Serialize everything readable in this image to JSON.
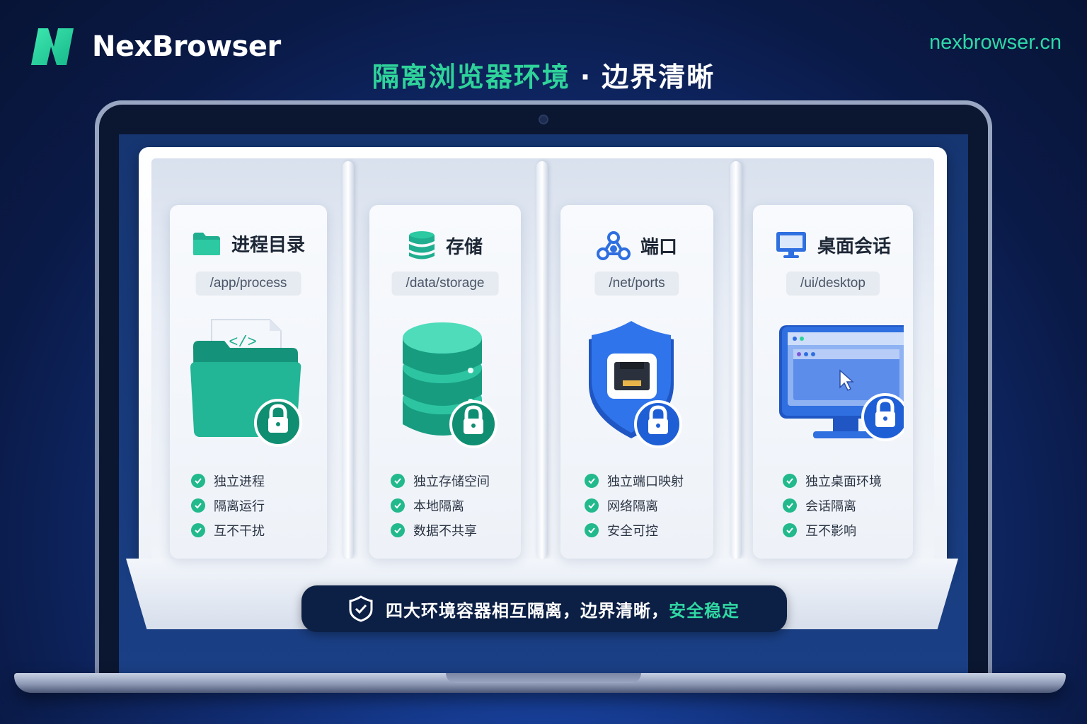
{
  "brand": {
    "name": "NexBrowser",
    "url": "nexbrowser.cn"
  },
  "headline": {
    "green": "隔离浏览器环境",
    "separator": "·",
    "white": "边界清晰"
  },
  "colors": {
    "accent_green": "#2fd39a",
    "teal": "#1fb39a",
    "blue": "#2f6fe0",
    "banner_bg": "#0c1f45"
  },
  "cards": [
    {
      "title": "进程目录",
      "path": "/app/process",
      "icon": "folder-icon",
      "illustration": "locked-code-folder",
      "features": [
        "独立进程",
        "隔离运行",
        "互不干扰"
      ]
    },
    {
      "title": "存储",
      "path": "/data/storage",
      "icon": "database-icon",
      "illustration": "locked-database",
      "features": [
        "独立存储空间",
        "本地隔离",
        "数据不共享"
      ]
    },
    {
      "title": "端口",
      "path": "/net/ports",
      "icon": "network-nodes-icon",
      "illustration": "locked-shield-port",
      "features": [
        "独立端口映射",
        "网络隔离",
        "安全可控"
      ]
    },
    {
      "title": "桌面会话",
      "path": "/ui/desktop",
      "icon": "monitor-icon",
      "illustration": "locked-desktop-window",
      "features": [
        "独立桌面环境",
        "会话隔离",
        "互不影响"
      ]
    }
  ],
  "banner": {
    "icon": "shield-check-icon",
    "text": "四大环境容器相互隔离，边界清晰，",
    "accent": "安全稳定"
  }
}
